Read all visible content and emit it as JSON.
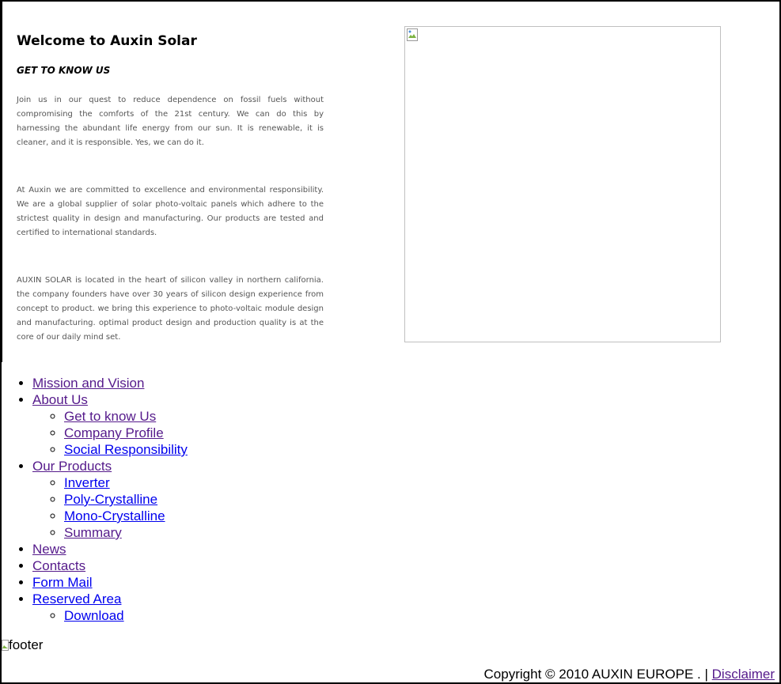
{
  "intro": {
    "title": "Welcome to Auxin Solar",
    "subtitle": "GET TO KNOW US",
    "paragraphs": [
      "Join us in our quest to reduce dependence on fossil fuels without compromising the comforts of the 21st century. We can do this by harnessing the abundant life energy from our sun. It is renewable, it is cleaner, and it is responsible. Yes, we can do it.",
      "At Auxin we are committed to excellence and environmental responsibility. We are a global supplier of solar photo-voltaic panels which adhere to the strictest quality in design and manufacturing. Our products are tested and certified to international standards.",
      "AUXIN SOLAR is located in the heart of silicon valley in northern california. the company founders have over 30 years of silicon design experience from concept to product. we bring this experience to photo-voltaic module design and manufacturing. optimal product design and production quality is at the core of our daily mind set."
    ]
  },
  "menu": {
    "mission": "Mission and Vision",
    "about": "About Us",
    "about_items": [
      "Get to know Us",
      "Company Profile",
      "Social Responsibility"
    ],
    "products": "Our Products",
    "product_items": [
      "Inverter",
      "Poly-Crystalline",
      "Mono-Crystalline",
      "Summary"
    ],
    "news": "News",
    "contacts": "Contacts",
    "form_mail": "Form Mail",
    "reserved": "Reserved Area",
    "reserved_items": [
      "Download"
    ]
  },
  "footer": {
    "image_alt": "footer",
    "copyright": "Copyright © 2010 AUXIN EUROPE .  |",
    "disclaimer": "Disclaimer"
  },
  "icons": {
    "hero_image": "broken-image-icon",
    "footer_image": "broken-image-icon"
  },
  "colors": {
    "visited_link": "#551a8b",
    "link": "#0000ee",
    "body_text_grey": "#555555"
  }
}
